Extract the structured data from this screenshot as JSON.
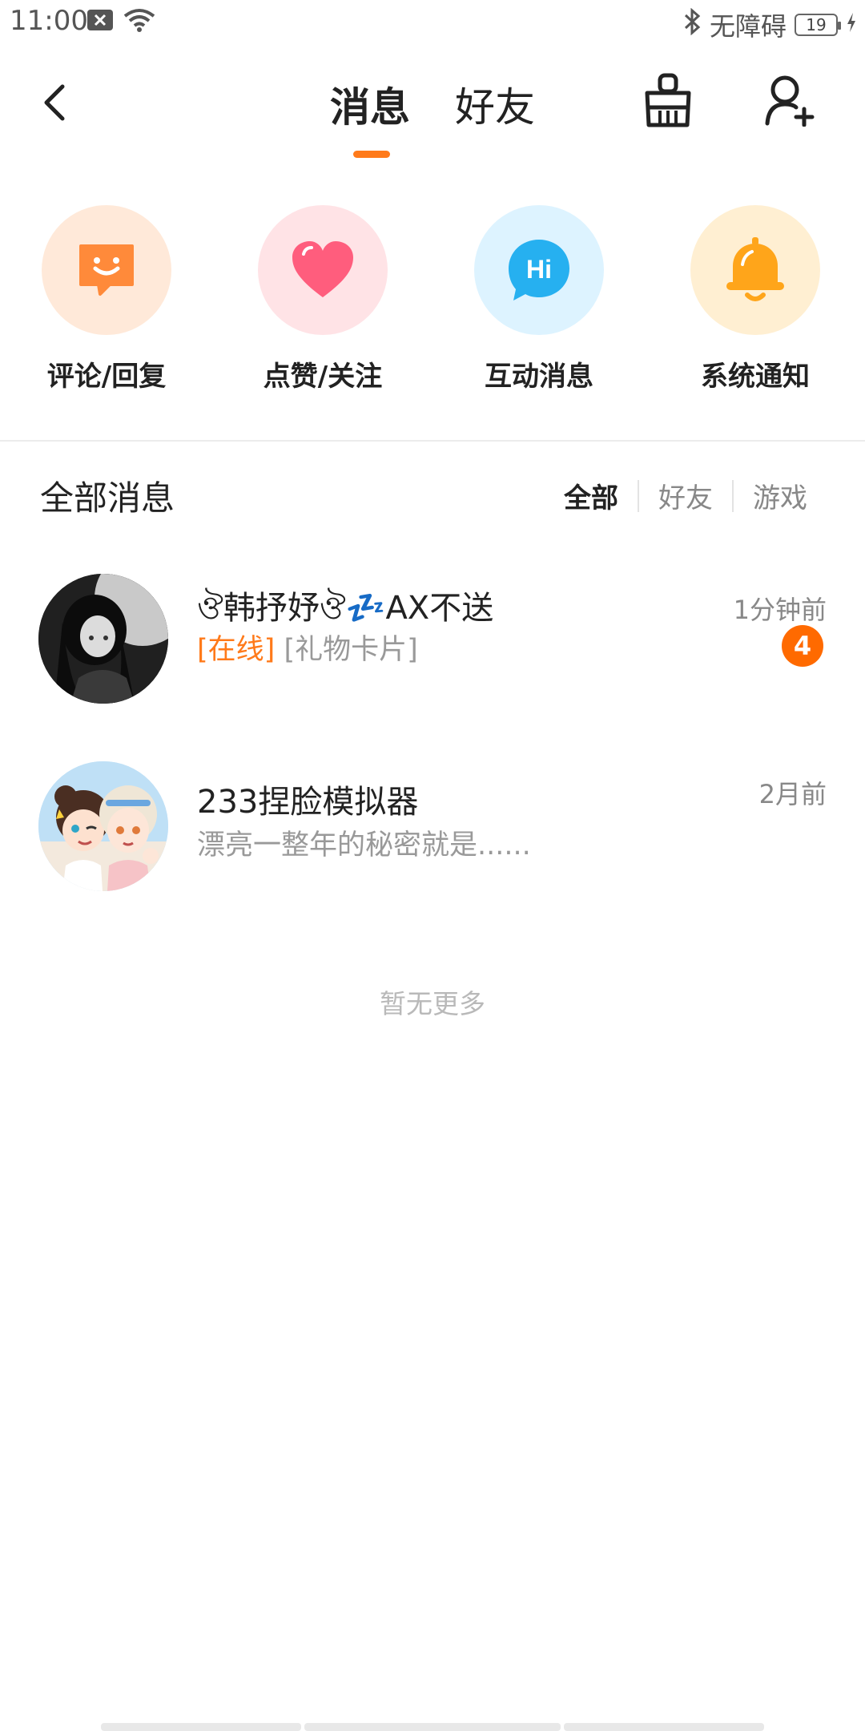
{
  "status_bar": {
    "time": "11:00",
    "accessibility_label": "无障碍",
    "battery_level": "19",
    "icons": [
      "close-box-icon",
      "wifi-icon",
      "bluetooth-icon",
      "battery-icon",
      "charging-icon"
    ]
  },
  "header": {
    "tabs": [
      {
        "label": "消息",
        "active": true
      },
      {
        "label": "好友",
        "active": false
      }
    ],
    "accent_color": "#ff7a1a"
  },
  "categories": [
    {
      "label": "评论/回复",
      "icon": "comment-icon",
      "bg_color": "#ffe9d9",
      "icon_color": "#ff8a3a"
    },
    {
      "label": "点赞/关注",
      "icon": "heart-icon",
      "bg_color": "#ffe3e6",
      "icon_color": "#ff5d7d"
    },
    {
      "label": "互动消息",
      "icon": "hi-bubble-icon",
      "bg_color": "#ddf3ff",
      "icon_color": "#26b0f0"
    },
    {
      "label": "系统通知",
      "icon": "bell-icon",
      "bg_color": "#ffefd2",
      "icon_color": "#ffa51a"
    }
  ],
  "section": {
    "title": "全部消息",
    "filters": [
      {
        "label": "全部",
        "active": true
      },
      {
        "label": "好友",
        "active": false
      },
      {
        "label": "游戏",
        "active": false
      }
    ]
  },
  "conversations": [
    {
      "name": "ঔ韩抒妤ঔ💤AX不送",
      "status_tag": "[在线]",
      "preview": "[礼物卡片]",
      "time": "1分钟前",
      "unread": "4"
    },
    {
      "name": "233捏脸模拟器",
      "preview": "漂亮一整年的秘密就是......",
      "time": "2月前"
    }
  ],
  "footer_text": "暂无更多"
}
